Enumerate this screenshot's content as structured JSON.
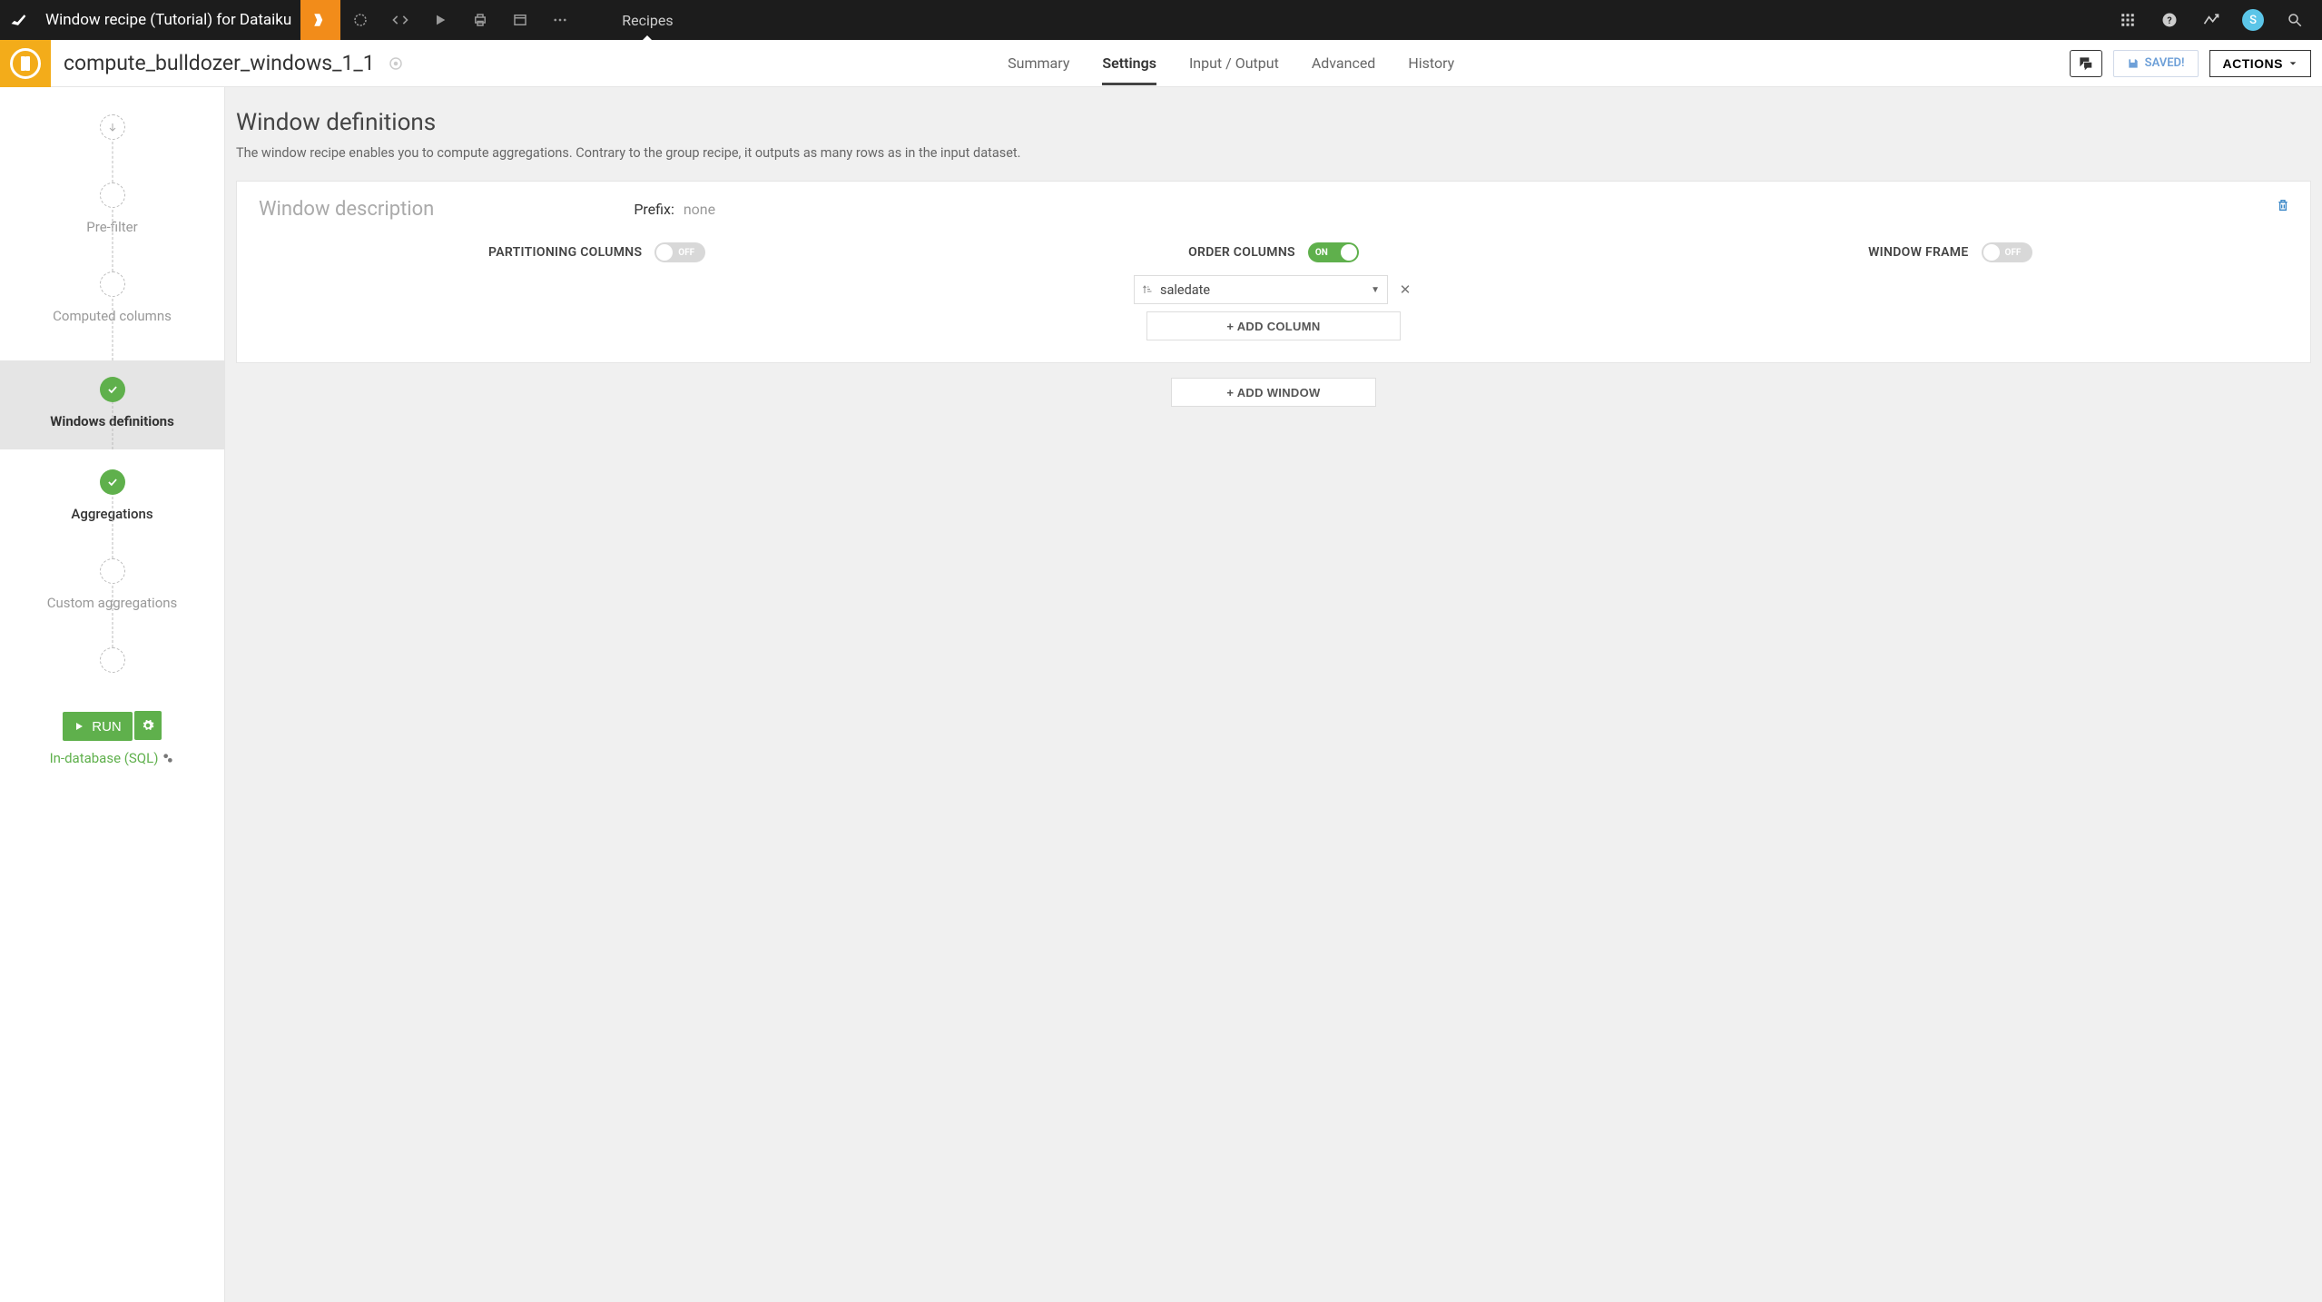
{
  "topbar": {
    "project_title": "Window recipe (Tutorial) for Dataiku",
    "recipes_tab": "Recipes",
    "avatar_initial": "S"
  },
  "subheader": {
    "recipe_name": "compute_bulldozer_windows_1_1",
    "tabs": {
      "summary": "Summary",
      "settings": "Settings",
      "input_output": "Input / Output",
      "advanced": "Advanced",
      "history": "History"
    },
    "saved_label": "SAVED!",
    "actions_label": "ACTIONS"
  },
  "sidebar": {
    "steps": {
      "pre_filter": "Pre-filter",
      "computed_columns": "Computed columns",
      "windows_definitions": "Windows definitions",
      "aggregations": "Aggregations",
      "custom_aggregations": "Custom aggregations"
    },
    "run_label": "RUN",
    "db_label": "In-database (SQL)"
  },
  "content": {
    "title": "Window definitions",
    "subtitle": "The window recipe enables you to compute aggregations. Contrary to the group recipe, it outputs as many rows as in the input dataset.",
    "panel_title": "Window description",
    "prefix_label": "Prefix:",
    "prefix_value": "none",
    "columns": {
      "partitioning": {
        "title": "PARTITIONING COLUMNS",
        "state": "OFF"
      },
      "order": {
        "title": "ORDER COLUMNS",
        "state": "ON",
        "selected": "saledate",
        "add_column": "+ ADD COLUMN"
      },
      "frame": {
        "title": "WINDOW FRAME",
        "state": "OFF"
      }
    },
    "add_window": "+ ADD WINDOW"
  }
}
